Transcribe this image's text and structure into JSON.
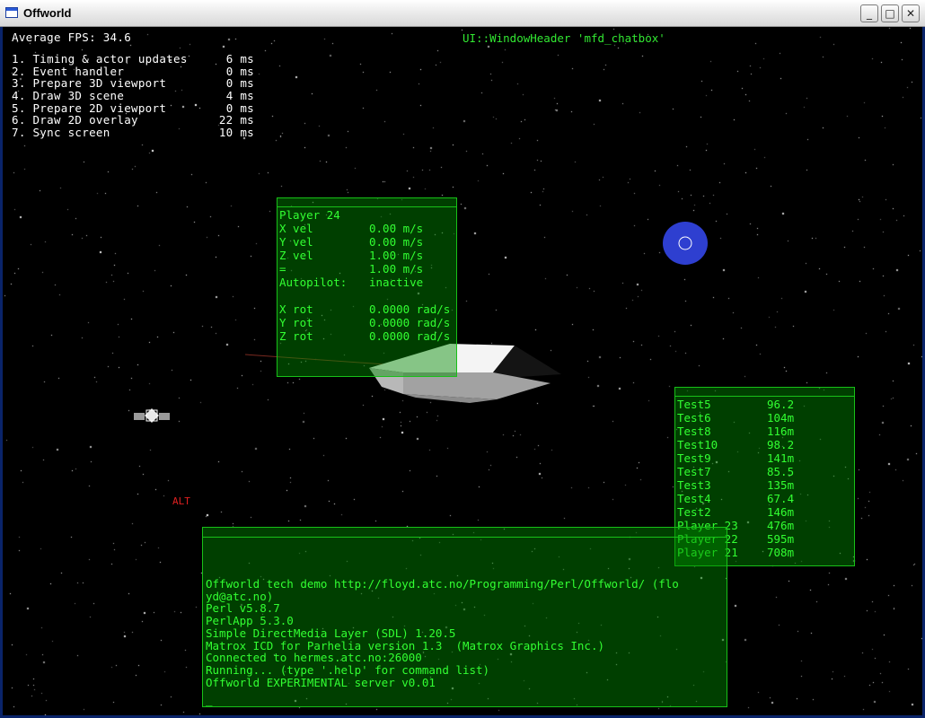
{
  "window": {
    "title": "Offworld",
    "buttons": {
      "minimize": "_",
      "maximize": "□",
      "close": "✕"
    }
  },
  "hud": {
    "fps_text": "Average FPS: 34.6",
    "window_header_label": "UI::WindowHeader 'mfd_chatbox'",
    "timings": [
      {
        "label": "1. Timing & actor updates",
        "value": "6 ms"
      },
      {
        "label": "2. Event handler",
        "value": "0 ms"
      },
      {
        "label": "3. Prepare 3D viewport",
        "value": "0 ms"
      },
      {
        "label": "4. Draw 3D scene",
        "value": "4 ms"
      },
      {
        "label": "5. Prepare 2D viewport",
        "value": "0 ms"
      },
      {
        "label": "6. Draw 2D overlay",
        "value": "22 ms"
      },
      {
        "label": "7. Sync screen",
        "value": "10 ms"
      }
    ],
    "alt_label": "ALT"
  },
  "player_panel": {
    "rows": [
      {
        "label": "Player 24",
        "value": ""
      },
      {
        "label": "X vel",
        "value": "0.00 m/s"
      },
      {
        "label": "Y vel",
        "value": "0.00 m/s"
      },
      {
        "label": "Z vel",
        "value": "1.00 m/s"
      },
      {
        "label": "=",
        "value": "1.00 m/s"
      },
      {
        "label": "Autopilot:",
        "value": "inactive"
      },
      {
        "label": "",
        "value": ""
      },
      {
        "label": "X rot",
        "value": "0.0000 rad/s"
      },
      {
        "label": "Y rot",
        "value": "0.0000 rad/s"
      },
      {
        "label": "Z rot",
        "value": "0.0000 rad/s"
      }
    ]
  },
  "ranking_panel": {
    "rows": [
      {
        "name": "Test5",
        "distance": "96.2"
      },
      {
        "name": "Test6",
        "distance": "104m"
      },
      {
        "name": "Test8",
        "distance": "116m"
      },
      {
        "name": "Test10",
        "distance": "98.2"
      },
      {
        "name": "Test9",
        "distance": "141m"
      },
      {
        "name": "Test7",
        "distance": "85.5"
      },
      {
        "name": "Test3",
        "distance": "135m"
      },
      {
        "name": "Test4",
        "distance": "67.4"
      },
      {
        "name": "Test2",
        "distance": "146m"
      },
      {
        "name": "Player 23",
        "distance": "476m"
      },
      {
        "name": "Player 22",
        "distance": "595m"
      },
      {
        "name": "Player 21",
        "distance": "708m"
      }
    ]
  },
  "chat_panel": {
    "lines": [
      "Offworld tech demo http://floyd.atc.no/Programming/Perl/Offworld/ (flo",
      "yd@atc.no)",
      "Perl v5.8.7",
      "PerlApp 5.3.0",
      "Simple DirectMedia Layer (SDL) 1.20.5",
      "Matrox ICD for Parhelia version 1.3  (Matrox Graphics Inc.)",
      "Connected to hermes.atc.no:26000",
      "Running... (type '.help' for command list)",
      "Offworld EXPERIMENTAL server v0.01"
    ],
    "cursor": "_"
  },
  "colors": {
    "hud_green": "#32ff32",
    "panel_fill": "rgba(0,140,0,0.45)",
    "alt_red": "#e02020",
    "planet_blue": "#2e3fd0"
  }
}
